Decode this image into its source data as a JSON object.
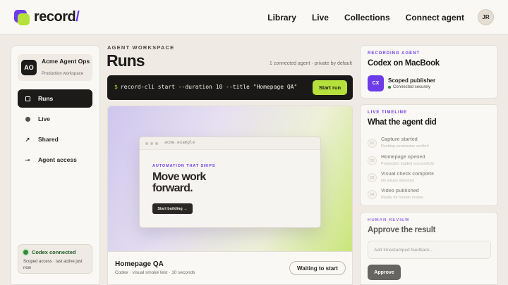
{
  "brand": {
    "name": "record",
    "slash": "/"
  },
  "nav": {
    "links": [
      "Library",
      "Live",
      "Collections",
      "Connect agent"
    ],
    "avatar_initials": "JR"
  },
  "sidebar": {
    "org": {
      "badge": "AO",
      "name": "Acme Agent Ops",
      "subtitle": "Production workspace"
    },
    "items": [
      {
        "label": "Runs",
        "icon": "square-icon",
        "active": true
      },
      {
        "label": "Live",
        "icon": "dot-icon",
        "active": false
      },
      {
        "label": "Shared",
        "icon": "arrow-up-right-icon",
        "glyph": "↗",
        "active": false
      },
      {
        "label": "Agent access",
        "icon": "key-icon",
        "glyph": "⊸",
        "active": false
      }
    ],
    "status_card": {
      "title": "Codex connected",
      "subtitle": "Scoped access · last active just now"
    }
  },
  "main": {
    "eyebrow": "AGENT WORKSPACE",
    "title": "Runs",
    "meta": "1 connected agent · private by default",
    "command": {
      "prompt": "$",
      "text": "record-cli start --duration 10 --title \"Homepage QA\"",
      "button_label": "Start run"
    },
    "preview": {
      "url": "acme.example",
      "tagline": "AUTOMATION THAT SHIPS",
      "headline": "Move work forward.",
      "cta_label": "Start building →"
    },
    "run": {
      "title": "Homepage QA",
      "subtitle": "Codex · visual smoke test · 10 seconds",
      "status_label": "Waiting to start"
    }
  },
  "recording_agent": {
    "eyebrow": "RECORDING AGENT",
    "title": "Codex on MacBook",
    "badge": "CX",
    "agent_name": "Scoped publisher",
    "agent_status": "Connected securely"
  },
  "timeline": {
    "eyebrow": "LIVE TIMELINE",
    "title": "What the agent did",
    "items": [
      {
        "num": "01",
        "title": "Capture started",
        "sub": "Desktop permission verified"
      },
      {
        "num": "02",
        "title": "Homepage opened",
        "sub": "Production loaded successfully"
      },
      {
        "num": "03",
        "title": "Visual check complete",
        "sub": "No issues detected"
      },
      {
        "num": "04",
        "title": "Video published",
        "sub": "Ready for human review"
      }
    ]
  },
  "review": {
    "eyebrow": "HUMAN REVIEW",
    "title": "Approve the result",
    "input_placeholder": "Add timestamped feedback...",
    "button_label": "Approve"
  },
  "colors": {
    "accent_purple": "#6c3ce9",
    "accent_lime": "#b6e13c",
    "dark": "#1d1b19",
    "status_green": "#2e8b36"
  }
}
